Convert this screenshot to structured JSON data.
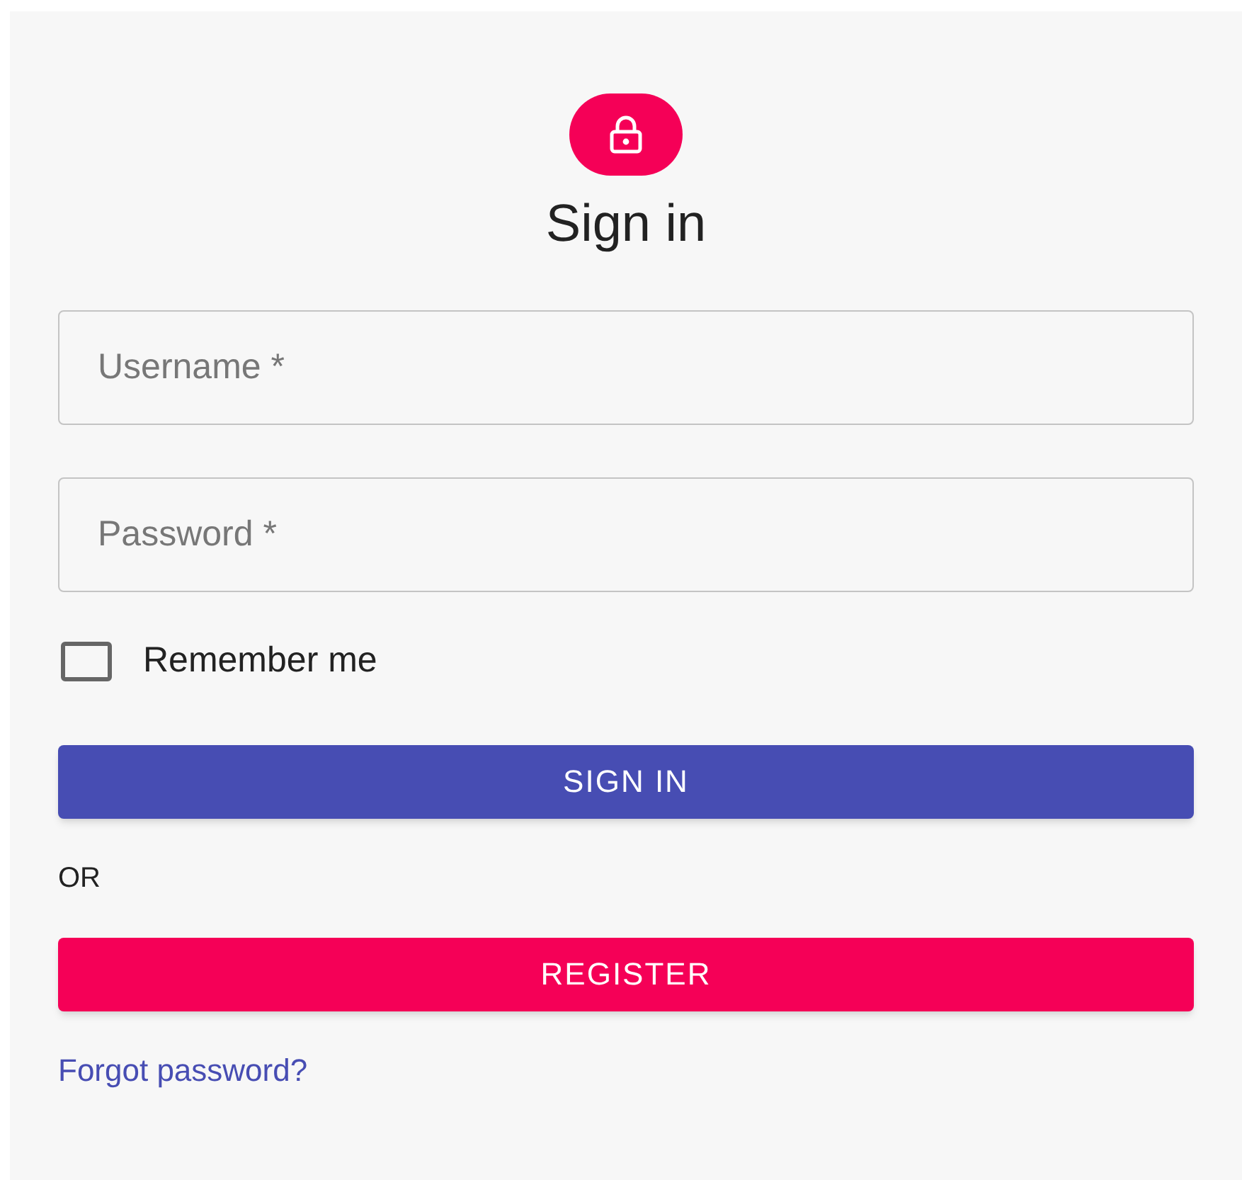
{
  "title": "Sign in",
  "fields": [
    {
      "placeholder": "Username *"
    },
    {
      "placeholder": "Password *"
    }
  ],
  "remember": {
    "label": "Remember me",
    "checked": false
  },
  "sign_in_button": "SIGN IN",
  "separator": "OR",
  "register_button": "REGISTER",
  "forgot_link": "Forgot password?"
}
